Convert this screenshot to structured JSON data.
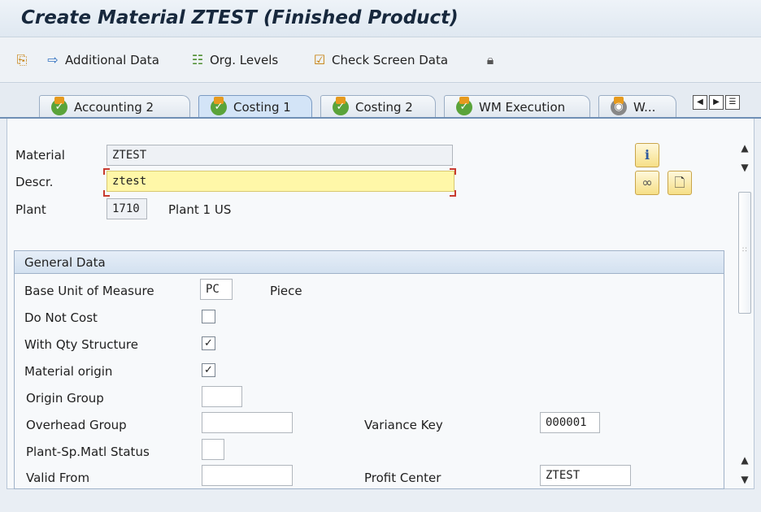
{
  "header": {
    "title": "Create Material ZTEST (Finished Product)"
  },
  "toolbar": {
    "items": [
      {
        "label": "",
        "icon": "copy-icon"
      },
      {
        "label": "Additional Data",
        "icon": "arrow-right-icon"
      },
      {
        "label": "Org. Levels",
        "icon": "org-levels-icon"
      },
      {
        "label": "Check Screen Data",
        "icon": "check-screen-data-icon"
      },
      {
        "label": "",
        "icon": "lock-icon"
      }
    ]
  },
  "tabs": [
    {
      "label": "Accounting 2",
      "active": false
    },
    {
      "label": "Costing 1",
      "active": true
    },
    {
      "label": "Costing 2",
      "active": false
    },
    {
      "label": "WM Execution",
      "active": false
    },
    {
      "label": "W...",
      "active": false
    }
  ],
  "header_fields": {
    "material": {
      "label": "Material",
      "value": "ZTEST"
    },
    "descr": {
      "label": "Descr.",
      "value": "ztest"
    },
    "plant": {
      "label": "Plant",
      "value": "1710",
      "text": "Plant 1 US"
    }
  },
  "general_data": {
    "title": "General Data",
    "base_uom": {
      "label": "Base Unit of Measure",
      "value": "PC",
      "text": "Piece"
    },
    "do_not_cost": {
      "label": "Do Not Cost",
      "checked": false
    },
    "with_qty_structure": {
      "label": "With Qty Structure",
      "checked": true,
      "mark": "✓"
    },
    "material_origin": {
      "label": "Material origin",
      "checked": true,
      "mark": "✓"
    },
    "origin_group": {
      "label": "Origin Group",
      "value": ""
    },
    "overhead_group": {
      "label": "Overhead Group",
      "value": ""
    },
    "variance_key": {
      "label": "Variance Key",
      "value": "000001"
    },
    "plant_sp_matl_status": {
      "label": "Plant-Sp.Matl Status",
      "value": ""
    },
    "valid_from": {
      "label": "Valid From",
      "value": ""
    },
    "profit_center": {
      "label": "Profit Center",
      "value": "ZTEST"
    }
  },
  "colors": {
    "focus_field": "#fff7a8",
    "active_tab": "#d3e4f7",
    "accent_blue": "#2e6fbf"
  }
}
